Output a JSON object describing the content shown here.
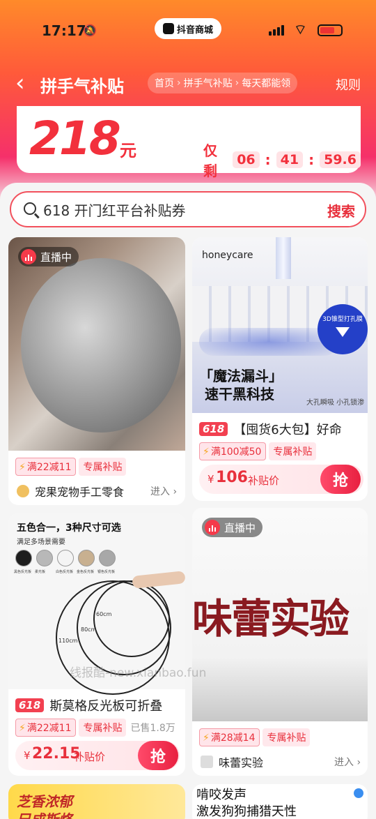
{
  "status": {
    "time": "17:17",
    "app_pill": "抖音商城"
  },
  "nav": {
    "title": "拼手气补贴",
    "crumbs": [
      "首页",
      "拼手气补贴",
      "每天都能领"
    ],
    "rules": "规则"
  },
  "banner": {
    "amount": "218",
    "unit": "元",
    "countdown_label": "仅剩",
    "hours": "06",
    "minutes": "41",
    "seconds": "59.6"
  },
  "search": {
    "value": "618 开门红平台补贴券",
    "button": "搜索"
  },
  "products": [
    {
      "live": "直播中",
      "coupon": "满22减11",
      "exclusive": "专属补贴",
      "shop": "宠果宠物手工零食",
      "enter": "进入"
    },
    {
      "brand": "honeycare",
      "headline1": "「魔法漏斗」",
      "headline2": "速干黑科技",
      "caption": "大孔瞬吸 小孔锁渗",
      "badge": "3D锥型打孔膜",
      "tag": "618",
      "title": "【囤货6大包】好命",
      "coupon": "满100减50",
      "exclusive": "专属补贴",
      "price_symbol": "¥",
      "price": "106",
      "price_label": "补贴价",
      "grab": "抢"
    },
    {
      "heading": "五色合一，3种尺寸可选",
      "subheading": "满足多场景需要",
      "swatches": [
        "黑色反光板",
        "柔光板",
        "白色反光板",
        "金色反光板",
        "银色反光板"
      ],
      "swatch_colors": [
        "#1e1e1e",
        "#b8b8b8",
        "#f4f4f4",
        "#c8b090",
        "#a8a8a8"
      ],
      "sizes": [
        "60cm",
        "80cm",
        "110cm"
      ],
      "tag": "618",
      "title": "斯莫格反光板可折叠",
      "coupon": "满22减11",
      "exclusive": "专属补贴",
      "sold": "已售1.8万",
      "price_symbol": "¥",
      "price": "22.15",
      "price_label": "补贴价",
      "grab": "抢"
    },
    {
      "live": "直播中",
      "banner_text": "味蕾实验",
      "coupon": "满28减14",
      "exclusive": "专属补贴",
      "shop": "味蕾实验",
      "enter": "进入"
    }
  ],
  "bottom_left": {
    "text1": "芝香浓郁",
    "text2": "巳成斯烙"
  },
  "bottom_right": {
    "line1": "啃咬发声",
    "line2": "激发狗狗捕猎天性"
  },
  "watermark": "线报酷-new.xianbao.fun",
  "colors": {
    "accent": "#e8303c",
    "header_start": "#ff8a2a",
    "header_end": "#f5306a"
  }
}
